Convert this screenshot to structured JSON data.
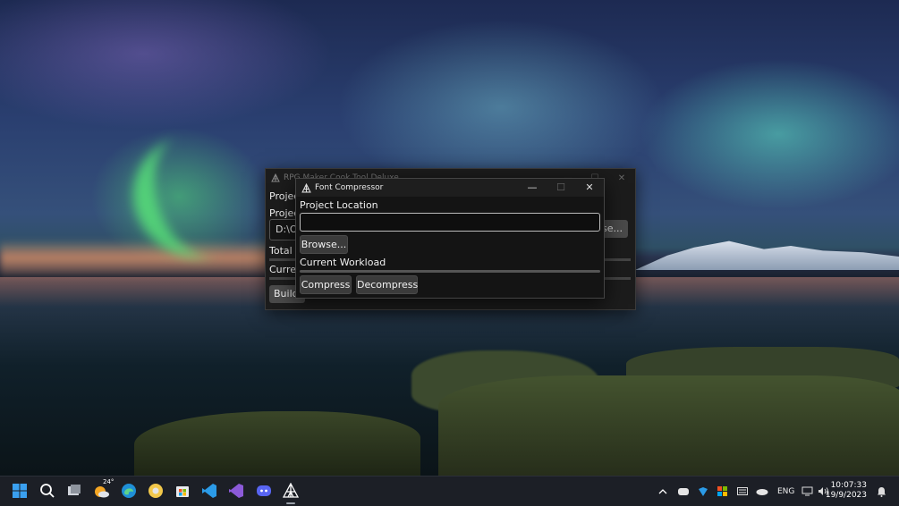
{
  "back_window": {
    "title": "RPG Maker Cook Tool Deluxe",
    "menu_label": "Projec",
    "project_label": "Projec",
    "project_path": "D:\\O",
    "browse_label": "se...",
    "total_label": "Total W",
    "current_label": "Curren",
    "build_label": "Build"
  },
  "compressor": {
    "title": "Font Compressor",
    "project_location_label": "Project Location",
    "project_location_value": "",
    "browse_label": "Browse...",
    "workload_label": "Current Workload",
    "workload_progress": 0,
    "compress_label": "Compress",
    "decompress_label": "Decompress",
    "minimize_glyph": "—",
    "maximize_glyph": "☐",
    "close_glyph": "✕"
  },
  "taskbar": {
    "weather_temp": "24°",
    "icons": [
      "windows-start-icon",
      "search-icon",
      "task-view-icon",
      "weather-icon",
      "edge-browser-icon",
      "chrome-icon",
      "microsoft-store-icon",
      "vscode-icon",
      "visual-studio-icon",
      "discord-icon",
      "rpg-maker-tool-icon"
    ],
    "tray": {
      "language": "ENG",
      "time": "10:07:33",
      "date": "19/9/2023"
    }
  },
  "colors": {
    "taskbar_bg": "#1c1f26",
    "window_bg": "#141414",
    "button_bg": "#3b3b3b"
  }
}
